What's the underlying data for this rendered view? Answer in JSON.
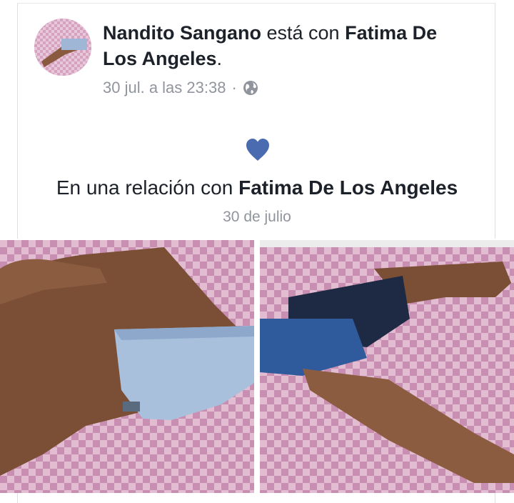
{
  "post": {
    "author": "Nandito Sangano",
    "connector": " está con ",
    "tagged": "Fatima De Los Angeles",
    "period": ".",
    "timestamp": "30 jul. a las 23:38",
    "separator": "·",
    "privacy_icon": "globe-icon"
  },
  "life_event": {
    "icon": "heart-icon",
    "prefix": "En una relación con ",
    "partner": "Fatima De Los Angeles",
    "date": "30 de julio"
  },
  "photos": [
    {
      "name": "photo-left"
    },
    {
      "name": "photo-right"
    }
  ],
  "colors": {
    "heart": "#4a6bb0",
    "meta_text": "#90949c",
    "body_text": "#1d2129",
    "bedsheet": "#c98fb2"
  }
}
